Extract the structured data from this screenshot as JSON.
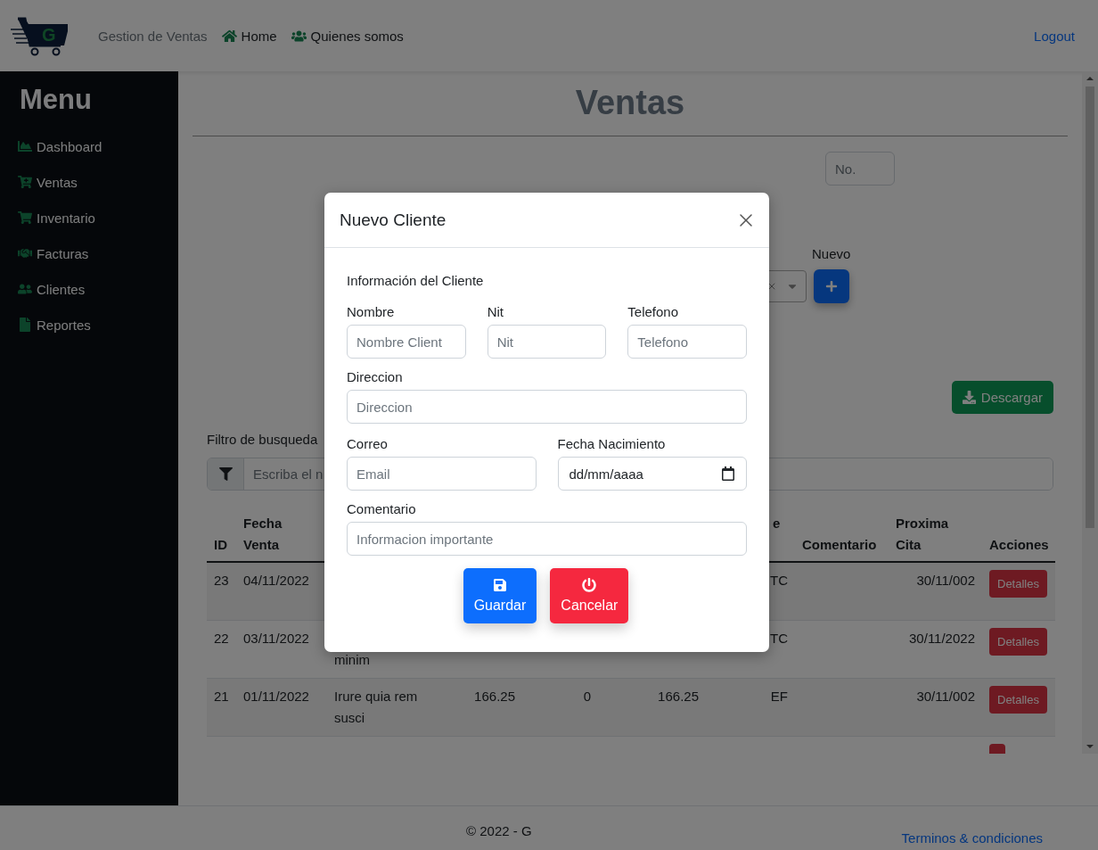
{
  "navbar": {
    "logo_letter": "G",
    "brand": "Gestion de Ventas",
    "links": [
      {
        "label": "Home"
      },
      {
        "label": "Quienes somos"
      }
    ],
    "logout": "Logout"
  },
  "sidebar": {
    "title": "Menu",
    "items": [
      {
        "label": "Dashboard"
      },
      {
        "label": "Ventas"
      },
      {
        "label": "Inventario"
      },
      {
        "label": "Facturas"
      },
      {
        "label": "Clientes"
      },
      {
        "label": "Reportes"
      }
    ]
  },
  "page": {
    "title": "Ventas",
    "number_placeholder": "No.",
    "new_label": "Nuevo",
    "download_button": "Descargar",
    "filter_label": "Filtro de busqueda",
    "search_placeholder": "Escriba el n"
  },
  "table": {
    "columns": [
      {
        "line2": "ID"
      },
      {
        "line1": "Fecha",
        "line2": "Venta"
      },
      {},
      {},
      {},
      {},
      {
        "line1": "e"
      },
      {
        "line2": "Comentario"
      },
      {
        "line1": "Proxima",
        "line2": "Cita"
      },
      {
        "line2": "Acciones"
      }
    ],
    "rows": [
      {
        "id": "23",
        "fecha_venta": "04/11/2022",
        "column_7": "TC",
        "proxima_cita": "30/11/002",
        "acciones": {
          "label": "Detalles"
        }
      },
      {
        "id": "22",
        "fecha_venta": "03/11/2022",
        "column_3": {
          "text": "minim",
          "hidden_first_line": true
        },
        "column_7": "TC",
        "proxima_cita": "30/11/2022",
        "acciones": {
          "label": "Detalles"
        }
      },
      {
        "id": "21",
        "fecha_venta": "01/11/2022",
        "column_3": "Irure quia rem susci",
        "column_4": "166.25",
        "column_5": "0",
        "column_6": "166.25",
        "column_7": "EF",
        "proxima_cita": "30/11/002",
        "acciones": {
          "label": "Detalles"
        }
      },
      {
        "acciones": {}
      }
    ]
  },
  "modal": {
    "title": "Nuevo Cliente",
    "section": "Información del Cliente",
    "groups": [
      {
        "fields": [
          {
            "label": "Nombre",
            "placeholder": "Nombre Client",
            "kind": "text"
          },
          {
            "label": "Nit",
            "placeholder": "Nit",
            "kind": "text"
          },
          {
            "label": "Telefono",
            "placeholder": "Telefono",
            "kind": "text"
          }
        ]
      },
      {
        "fields": [
          {
            "label": "Direccion",
            "placeholder": "Direccion",
            "kind": "text"
          }
        ]
      },
      {
        "fields": [
          {
            "label": "Correo",
            "placeholder": "Email",
            "kind": "text"
          },
          {
            "label": "Fecha Nacimiento",
            "value": "dd/mm/aaaa",
            "kind": "date"
          }
        ]
      },
      {
        "fields": [
          {
            "label": "Comentario",
            "placeholder": "Informacion importante",
            "kind": "text"
          }
        ]
      }
    ],
    "buttons": [
      {
        "label": "Guardar",
        "kind": "save"
      },
      {
        "label": "Cancelar",
        "kind": "cancel"
      }
    ]
  },
  "footer": {
    "copyright": "© 2022 - G",
    "link": "Terminos & condiciones"
  }
}
